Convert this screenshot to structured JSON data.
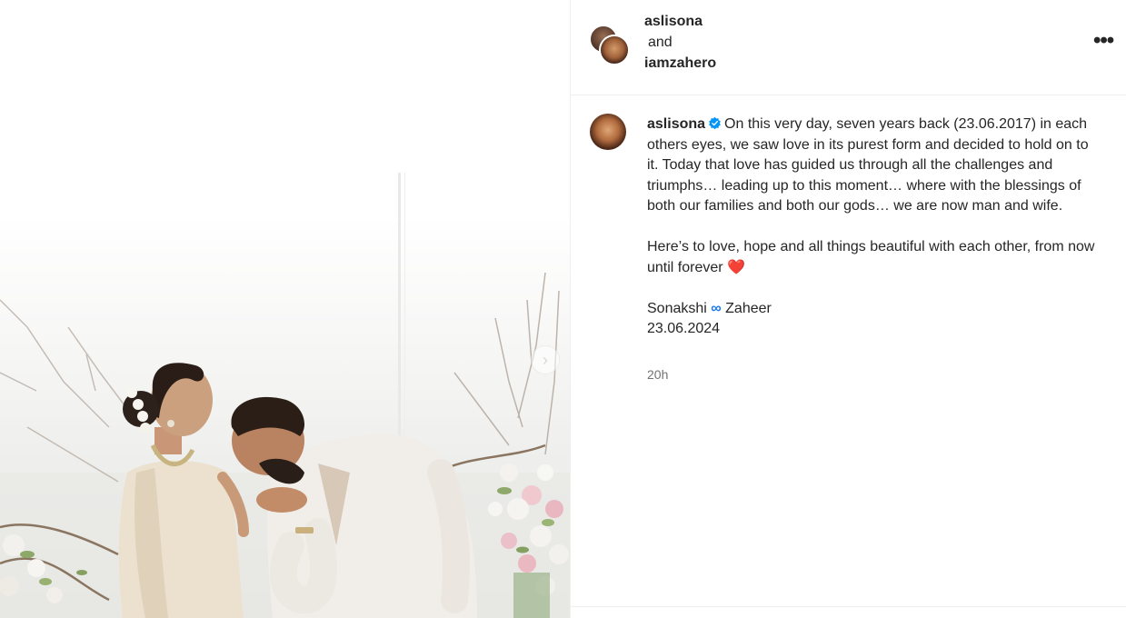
{
  "post": {
    "image_alt": "Wedding photo of a couple in a floral setting",
    "next_icon": "chevron-right"
  },
  "header": {
    "user1": "aslisona",
    "and_text": "and",
    "user2": "iamzahero",
    "more_icon": "•••"
  },
  "caption": {
    "username": "aslisona",
    "verified_icon": "verified-badge",
    "para1": "On this very day, seven years back (23.06.2017) in each others eyes, we saw love in its purest form and decided to hold on to it. Today that love has guided us through all the challenges and triumphs… leading up to this moment… where with the blessings of both our families and both our gods… we are now man and wife.",
    "para2": "Here’s to love, hope and all things beautiful with each other, from now until forever",
    "heart": "❤️",
    "sign_name1": "Sonakshi",
    "infinity": "∞",
    "sign_name2": "Zaheer",
    "date": "23.06.2024"
  },
  "timestamp": "20h",
  "colors": {
    "verified": "#0095f6",
    "heart": "#ed1c3c",
    "infinity": "#1877f2"
  }
}
